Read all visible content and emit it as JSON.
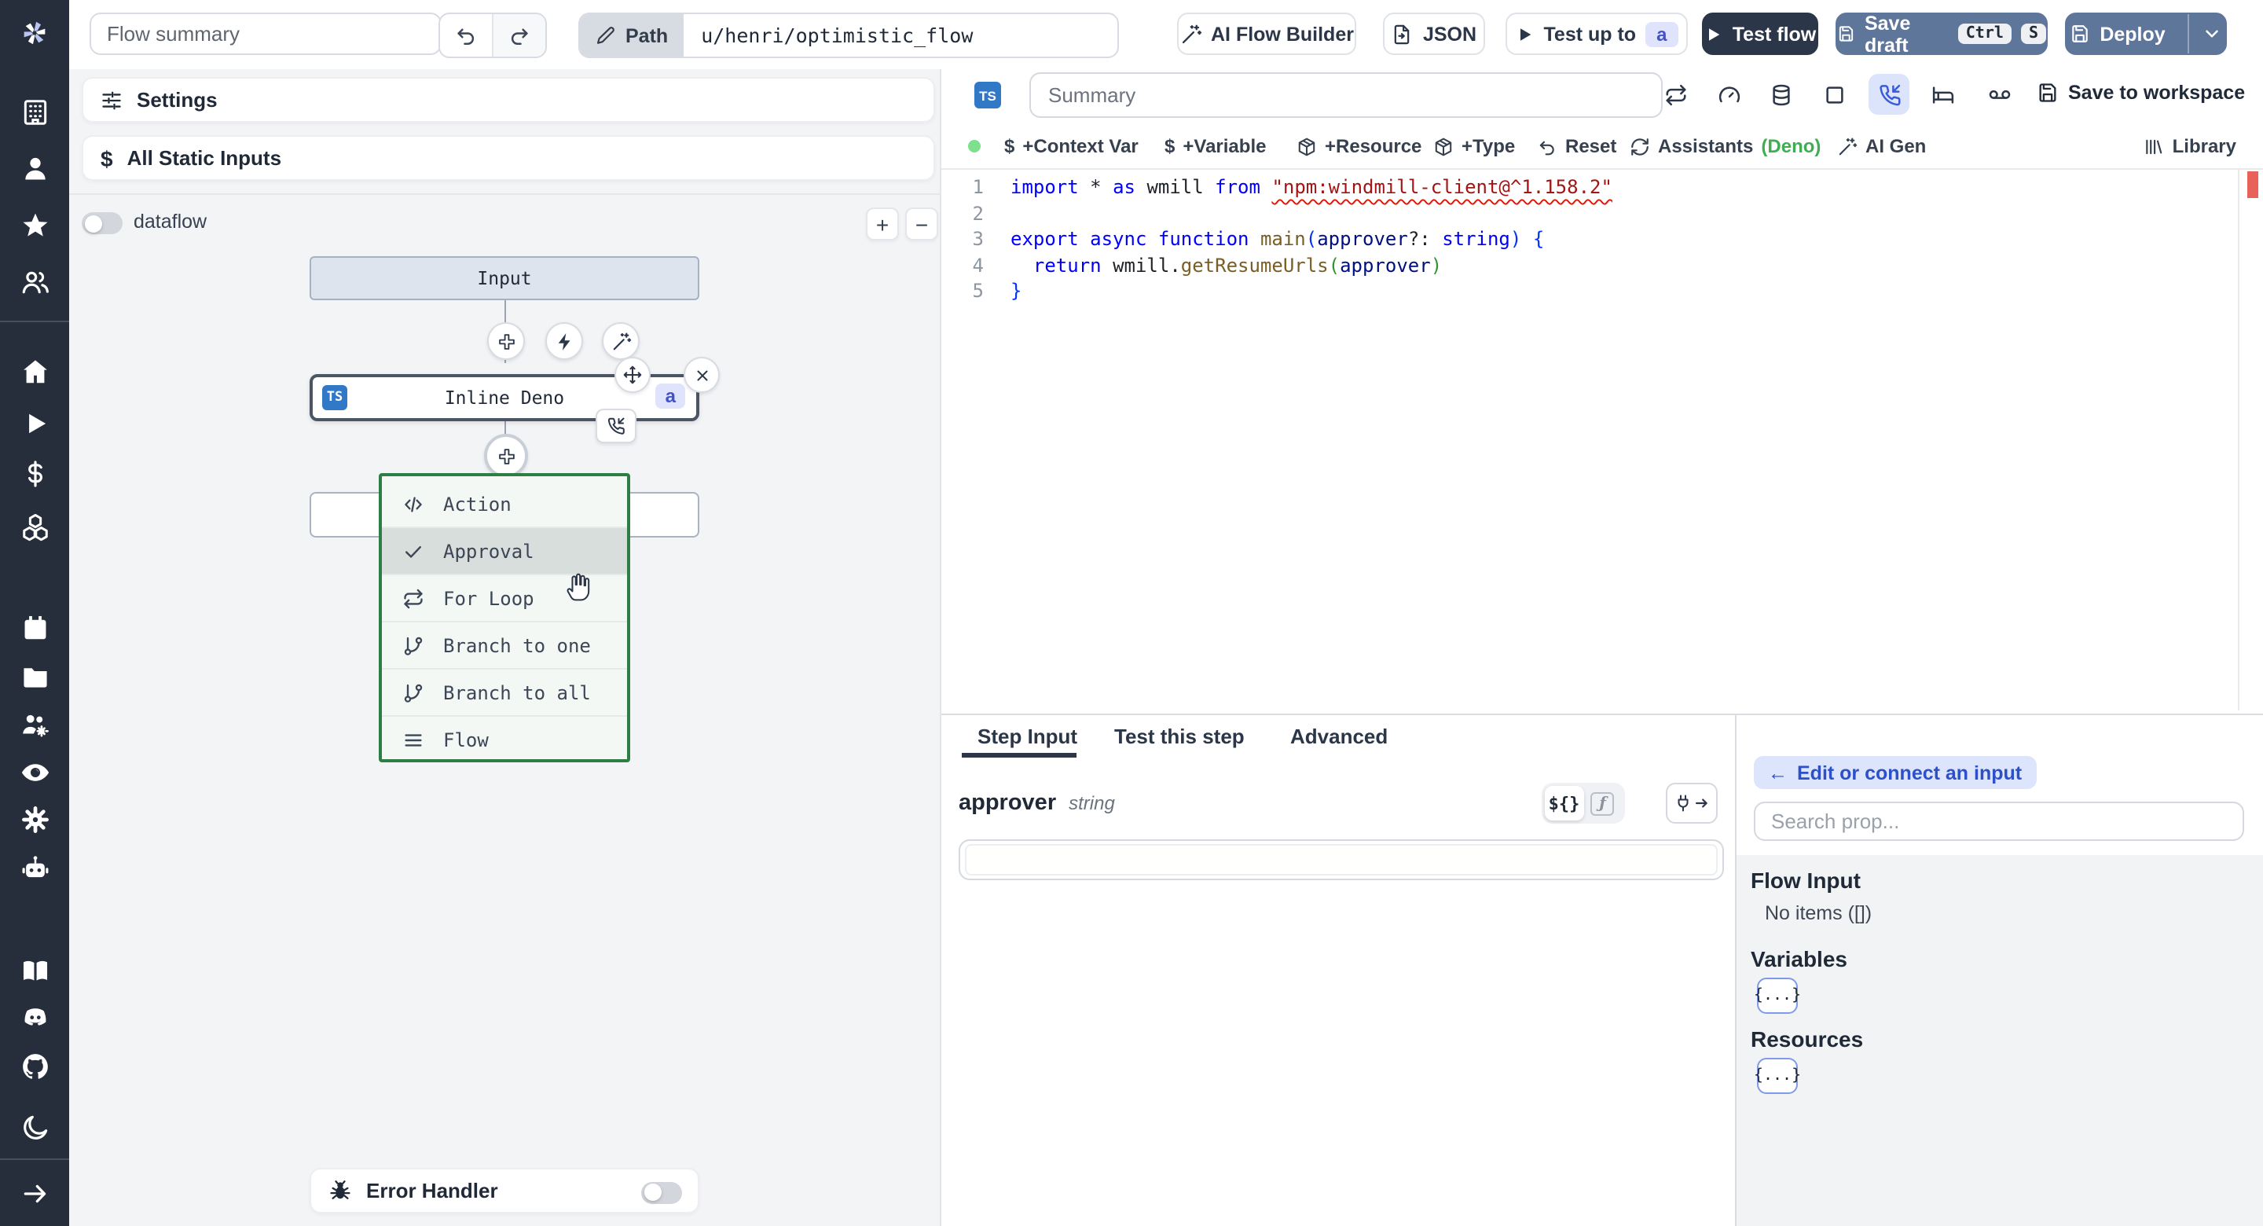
{
  "topbar": {
    "flow_summary_placeholder": "Flow summary",
    "path_label": "Path",
    "path_value": "u/henri/optimistic_flow",
    "ai_flow_builder": "AI Flow Builder",
    "json_label": "JSON",
    "test_up_to": "Test up to",
    "test_up_to_badge": "a",
    "test_flow": "Test flow",
    "save_draft": "Save draft",
    "save_draft_kbd": [
      "Ctrl",
      "S"
    ],
    "deploy": "Deploy"
  },
  "sidebar": {
    "icons": [
      "windmill-logo",
      "building",
      "user",
      "star",
      "users",
      "home",
      "play",
      "dollar",
      "boxes",
      "calendar",
      "folder",
      "users-cog",
      "eye",
      "settings-gear",
      "bot",
      "book-open",
      "discord",
      "github",
      "moon",
      "expand-arrow"
    ]
  },
  "canvas": {
    "settings_label": "Settings",
    "static_inputs_label": "All Static Inputs",
    "dataflow_label": "dataflow",
    "zoom_in": "+",
    "zoom_out": "−",
    "input_node_label": "Input",
    "step_node": {
      "lang_badge": "TS",
      "label": "Inline Deno",
      "suffix_badge": "a"
    },
    "menu": {
      "items": [
        {
          "label": "Action",
          "icon": "code"
        },
        {
          "label": "Approval",
          "icon": "check",
          "highlighted": true
        },
        {
          "label": "For Loop",
          "icon": "repeat"
        },
        {
          "label": "Branch to one",
          "icon": "git-branch"
        },
        {
          "label": "Branch to all",
          "icon": "git-branch"
        },
        {
          "label": "Flow",
          "icon": "bars"
        }
      ]
    },
    "error_handler_label": "Error Handler"
  },
  "editor": {
    "lang_badge": "TS",
    "summary_placeholder": "Summary",
    "header_icons": [
      "repeat",
      "gauge",
      "database",
      "square",
      "phone-incoming",
      "bed",
      "voicemail"
    ],
    "selected_header_icon": "phone-incoming",
    "save_to_workspace": "Save to workspace",
    "toolbar": {
      "context_var": "+Context Var",
      "variable": "+Variable",
      "resource": "+Resource",
      "type": "+Type",
      "reset": "Reset",
      "assistants": "Assistants",
      "assistants_lang": "(Deno)",
      "ai_gen": "AI Gen",
      "library": "Library"
    },
    "code": {
      "lines": [
        {
          "n": "1",
          "tokens": [
            {
              "c": "k",
              "t": "import"
            },
            {
              "c": "p",
              "t": " * "
            },
            {
              "c": "k",
              "t": "as"
            },
            {
              "c": "p",
              "t": " wmill "
            },
            {
              "c": "k",
              "t": "from"
            },
            {
              "c": "p",
              "t": " "
            },
            {
              "c": "s",
              "t": "\"npm:windmill-client@^1.158.2\"",
              "sq": true
            }
          ]
        },
        {
          "n": "2",
          "tokens": []
        },
        {
          "n": "3",
          "tokens": [
            {
              "c": "k",
              "t": "export "
            },
            {
              "c": "k",
              "t": "async "
            },
            {
              "c": "k",
              "t": "function "
            },
            {
              "c": "f",
              "t": "main"
            },
            {
              "c": "b1",
              "t": "("
            },
            {
              "c": "prm",
              "t": "approver"
            },
            {
              "c": "p",
              "t": "?: "
            },
            {
              "c": "k",
              "t": "string"
            },
            {
              "c": "b1",
              "t": ") "
            },
            {
              "c": "b1",
              "t": "{"
            }
          ]
        },
        {
          "n": "4",
          "tokens": [
            {
              "c": "p",
              "t": "  "
            },
            {
              "c": "k",
              "t": "return"
            },
            {
              "c": "p",
              "t": " wmill."
            },
            {
              "c": "f",
              "t": "getResumeUrls"
            },
            {
              "c": "b2",
              "t": "("
            },
            {
              "c": "prm",
              "t": "approver"
            },
            {
              "c": "b2",
              "t": ")"
            }
          ]
        },
        {
          "n": "5",
          "tokens": [
            {
              "c": "b1",
              "t": "}"
            }
          ]
        }
      ]
    }
  },
  "step_panel": {
    "tabs": [
      {
        "label": "Step Input",
        "active": true
      },
      {
        "label": "Test this step"
      },
      {
        "label": "Advanced"
      }
    ],
    "field": {
      "name": "approver",
      "type": "string"
    },
    "editor_toggle": {
      "template": "${}",
      "function": "ƒ"
    }
  },
  "prop_picker": {
    "back_button": "Edit or connect an input",
    "back_arrow": "←",
    "search_placeholder": "Search prop...",
    "flow_input_title": "Flow Input",
    "flow_input_empty": "No items ([])",
    "variables_title": "Variables",
    "variables_chip": "{...}",
    "resources_title": "Resources",
    "resources_chip": "{...}"
  },
  "colors": {
    "sidebar_bg": "#262d3b",
    "steel_blue_button": "#5f769b",
    "dark_navy_button": "#2b3648",
    "ts_badge_blue": "#3178c6",
    "menu_border_green": "#2e7d45",
    "deno_green": "#3fae52",
    "error_mark_red": "#e8625a",
    "selected_icon_bg": "#dbe4fb",
    "indigo_badge_bg": "#dfe3fc",
    "indigo_badge_text": "#4353c7"
  }
}
